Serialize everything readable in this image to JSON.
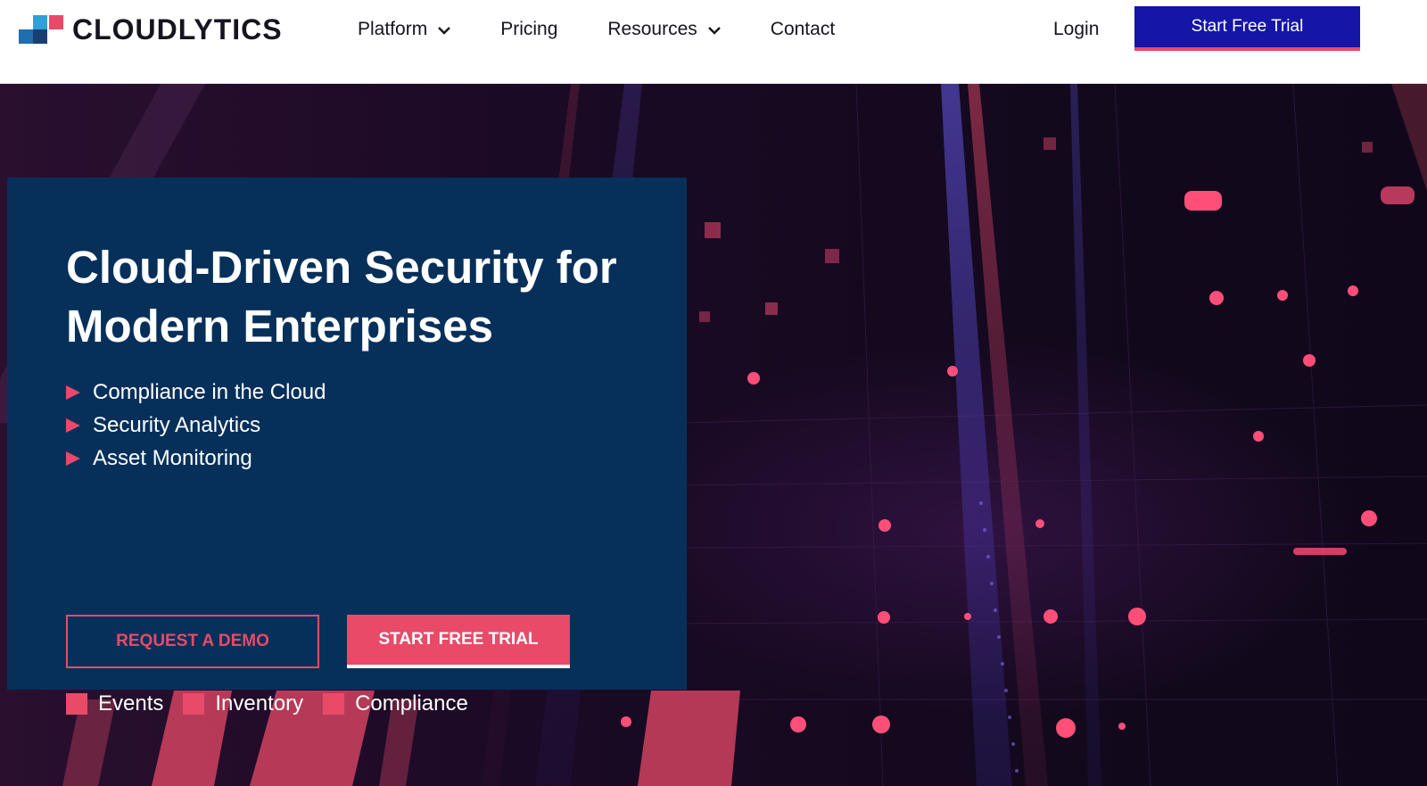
{
  "brand": {
    "name": "CLOUDLYTICS",
    "accent": "#e84a68",
    "primary": "#1515a8",
    "panel": "#06305a"
  },
  "nav": {
    "items": [
      {
        "label": "Platform",
        "has_dropdown": true
      },
      {
        "label": "Pricing",
        "has_dropdown": false
      },
      {
        "label": "Resources",
        "has_dropdown": true
      },
      {
        "label": "Contact",
        "has_dropdown": false
      }
    ],
    "login": "Login",
    "cta": "Start Free Trial"
  },
  "hero": {
    "headline": "Cloud-Driven Security for Modern Enterprises",
    "features": [
      "Compliance in the Cloud",
      "Security Analytics",
      "Asset Monitoring"
    ],
    "buttons": {
      "demo": "REQUEST A DEMO",
      "trial": "START FREE TRIAL"
    },
    "tags": [
      "Events",
      "Inventory",
      "Compliance"
    ]
  }
}
